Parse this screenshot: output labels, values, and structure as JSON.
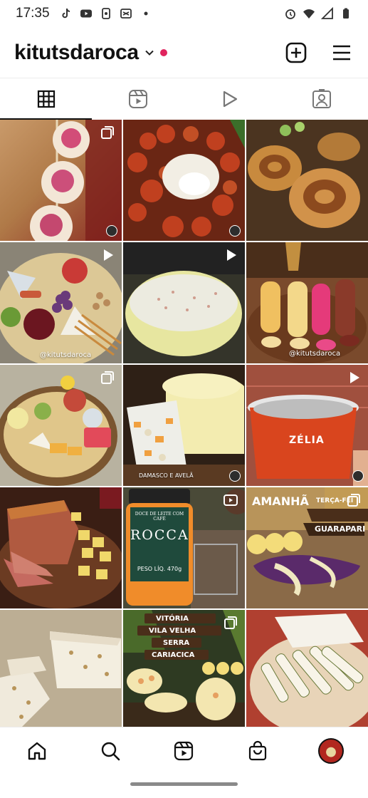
{
  "status_bar": {
    "time": "17:35",
    "left_icons": [
      "tiktok-icon",
      "youtube-icon",
      "phone-bank-icon",
      "capcut-icon",
      "dot-icon"
    ],
    "right_icons": [
      "alarm-icon",
      "wifi-icon",
      "signal-icon",
      "battery-icon"
    ]
  },
  "header": {
    "username": "kitutsdaroca",
    "chevron_icon": "chevron-down-icon",
    "notification_dot_color": "#e0245e",
    "actions": [
      "create-icon",
      "menu-icon"
    ]
  },
  "tabs": [
    {
      "icon": "grid-icon",
      "active": true
    },
    {
      "icon": "reels-icon",
      "active": false
    },
    {
      "icon": "play-icon",
      "active": false
    },
    {
      "icon": "tagged-icon",
      "active": false
    }
  ],
  "grid": {
    "posts": [
      {
        "badge": "carousel",
        "bg": "#b47a48"
      },
      {
        "badge": "none",
        "bg": "#7a2a16"
      },
      {
        "badge": "none",
        "bg": "#5a3a1e"
      },
      {
        "badge": "reel",
        "bg": "#cbb98a",
        "caption": "@kitutsdaroca"
      },
      {
        "badge": "reel",
        "bg": "#3a3a2a"
      },
      {
        "badge": "none",
        "bg": "#6b3e1f",
        "caption": "@kitutsdaroca"
      },
      {
        "badge": "carousel",
        "bg": "#5a4630"
      },
      {
        "badge": "none",
        "bg": "#3b2a1a",
        "caption": "DAMASCO E AVELÃ"
      },
      {
        "badge": "reel",
        "bg": "#b04c3a",
        "brand": "ZÉLIA"
      },
      {
        "badge": "none",
        "bg": "#5a2c1f"
      },
      {
        "badge": "reel",
        "bg": "#2e4a3a",
        "jar_title": "DOCE DE LEITE COM CAFÉ",
        "jar_brand": "ROCCA",
        "jar_weight": "PESO LÍQ. 470g"
      },
      {
        "badge": "carousel",
        "bg": "#6f4a2c",
        "overlay_1": "AMANHÃ",
        "overlay_2": "TERÇA-FEI",
        "overlay_3": "GUARAPARI"
      },
      {
        "badge": "none",
        "bg": "#c9b89a"
      },
      {
        "badge": "carousel",
        "bg": "#3a4a2a",
        "cities": [
          "VITÓRIA",
          "VILA VELHA",
          "SERRA",
          "CARIACICA"
        ]
      },
      {
        "badge": "none",
        "bg": "#a83a2a"
      }
    ]
  },
  "bottom_nav": [
    "home-icon",
    "search-icon",
    "reels-nav-icon",
    "shop-icon",
    "profile-avatar"
  ],
  "colors": {
    "accent": "#e0245e",
    "text": "#111111",
    "divider": "#ececec"
  }
}
